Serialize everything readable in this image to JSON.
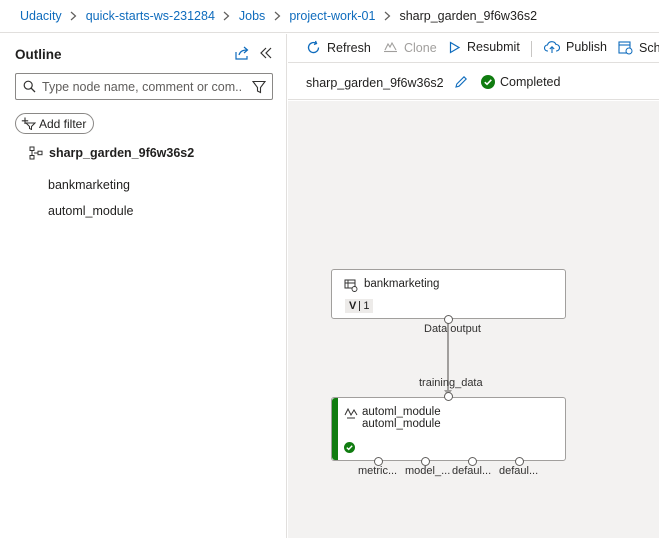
{
  "breadcrumb": {
    "items": [
      "Udacity",
      "quick-starts-ws-231284",
      "Jobs",
      "project-work-01"
    ],
    "current": "sharp_garden_9f6w36s2"
  },
  "outline": {
    "title": "Outline",
    "search_placeholder": "Type node name, comment or com...",
    "add_filter_label": "Add filter",
    "root_label": "sharp_garden_9f6w36s2",
    "items": [
      "bankmarketing",
      "automl_module"
    ]
  },
  "toolbar": {
    "refresh": "Refresh",
    "clone": "Clone",
    "resubmit": "Resubmit",
    "publish": "Publish",
    "schedule": "Sche"
  },
  "job": {
    "name": "sharp_garden_9f6w36s2",
    "status": "Completed",
    "status_color": "#107c10"
  },
  "graph": {
    "dataset_node": {
      "title": "bankmarketing",
      "version_prefix": "V",
      "version": "1",
      "output_label": "Data output"
    },
    "module_node": {
      "title": "automl_module",
      "subtitle": "automl_module",
      "input_label": "training_data",
      "outputs": [
        "metric...",
        "model_...",
        "defaul...",
        "defaul..."
      ]
    }
  },
  "colors": {
    "link": "#0f6cbd",
    "success": "#107c10",
    "canvas": "#f3f2f1"
  }
}
